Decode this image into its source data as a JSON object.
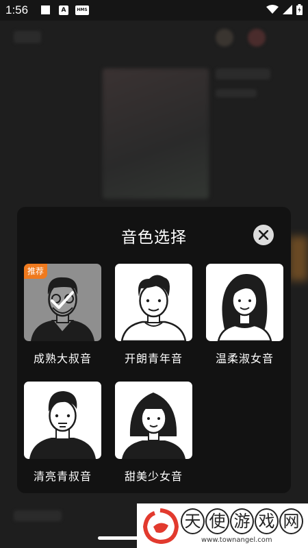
{
  "status_bar": {
    "time": "1:56",
    "icon_a": "A",
    "icon_hms": "HMS"
  },
  "dialog": {
    "title": "音色选择",
    "voices": [
      {
        "label": "成熟大叔音",
        "badge": "推荐",
        "selected": true
      },
      {
        "label": "开朗青年音"
      },
      {
        "label": "温柔淑女音"
      },
      {
        "label": "清亮青叔音"
      },
      {
        "label": "甜美少女音"
      }
    ]
  },
  "watermark": {
    "chars": [
      "天",
      "使",
      "游",
      "戏",
      "网"
    ],
    "url": "www.townangel.com"
  },
  "colors": {
    "dialog_bg": "#121212",
    "badge": "#ef7a1e",
    "card_bg": "#ffffff",
    "selected_card_bg": "#8f8f8f"
  }
}
